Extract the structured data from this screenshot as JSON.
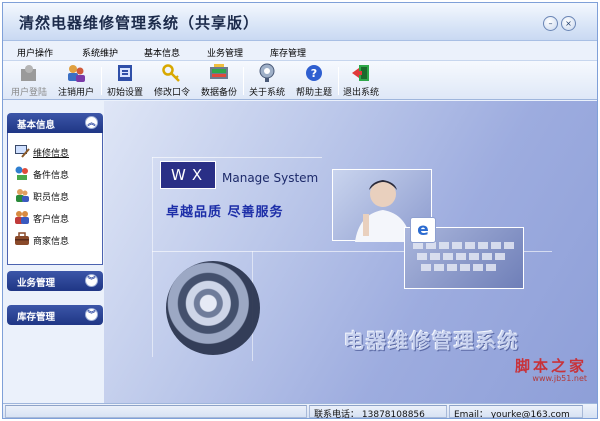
{
  "app": {
    "title": "清然电器维修管理系统（共享版）"
  },
  "window_controls": {
    "minimize": "–",
    "close": "×"
  },
  "menu": [
    {
      "label": "用户操作"
    },
    {
      "label": "系统维护"
    },
    {
      "label": "基本信息"
    },
    {
      "label": "业务管理"
    },
    {
      "label": "库存管理"
    }
  ],
  "toolbar": [
    {
      "label": "用户登陆",
      "icon": "user-login-icon",
      "enabled": false
    },
    {
      "label": "注销用户",
      "icon": "logout-user-icon",
      "enabled": true
    },
    {
      "label": "初始设置",
      "icon": "init-settings-icon",
      "enabled": true
    },
    {
      "label": "修改口令",
      "icon": "key-icon",
      "enabled": true
    },
    {
      "label": "数据备份",
      "icon": "backup-icon",
      "enabled": true
    },
    {
      "label": "关于系统",
      "icon": "about-icon",
      "enabled": true
    },
    {
      "label": "帮助主题",
      "icon": "help-icon",
      "enabled": true
    },
    {
      "label": "退出系统",
      "icon": "exit-icon",
      "enabled": true
    }
  ],
  "sidebar": {
    "groups": [
      {
        "title": "基本信息",
        "expanded": true,
        "chevron": "︽",
        "items": [
          {
            "label": "维修信息",
            "icon": "repair-icon",
            "selected": true
          },
          {
            "label": "备件信息",
            "icon": "parts-icon",
            "selected": false
          },
          {
            "label": "职员信息",
            "icon": "staff-icon",
            "selected": false
          },
          {
            "label": "客户信息",
            "icon": "customer-icon",
            "selected": false
          },
          {
            "label": "商家信息",
            "icon": "merchant-icon",
            "selected": false
          }
        ]
      },
      {
        "title": "业务管理",
        "expanded": false,
        "chevron": "︾"
      },
      {
        "title": "库存管理",
        "expanded": false,
        "chevron": "︾"
      }
    ]
  },
  "banner": {
    "wx": "WX",
    "manage_text": "Manage System",
    "slogan": "卓越品质 尽善服务",
    "system_name": "电器维修管理系统",
    "e_logo": "e"
  },
  "site_watermark": {
    "name": "脚本之家",
    "url": "www.jb51.net"
  },
  "status": {
    "phone_label": "联系电话：",
    "phone": "13878108856",
    "email_label": "Email：",
    "email": "yourke@163.com"
  },
  "colors": {
    "sidebar_header": "#1f3685",
    "wx_box": "#2a2f86",
    "slogan": "#1d2ea8",
    "watermark_red": "#c8323a"
  }
}
